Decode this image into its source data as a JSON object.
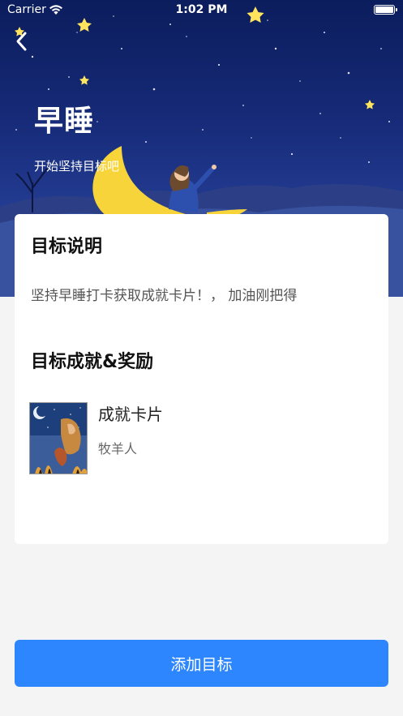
{
  "status_bar": {
    "carrier": "Carrier",
    "time": "1:02 PM"
  },
  "header": {
    "back_icon": "chevron-left-icon",
    "title": "早睡",
    "subtitle": "开始坚持目标吧"
  },
  "goal": {
    "description_title": "目标说明",
    "description": "坚持早睡打卡获取成就卡片！， 加油刚把得",
    "rewards_title": "目标成就&奖励",
    "reward": {
      "name": "成就卡片",
      "author": "牧羊人"
    }
  },
  "actions": {
    "add_label": "添加目标"
  },
  "colors": {
    "accent": "#2e86ff",
    "hero": "#162a78",
    "moon": "#f7d43a"
  }
}
